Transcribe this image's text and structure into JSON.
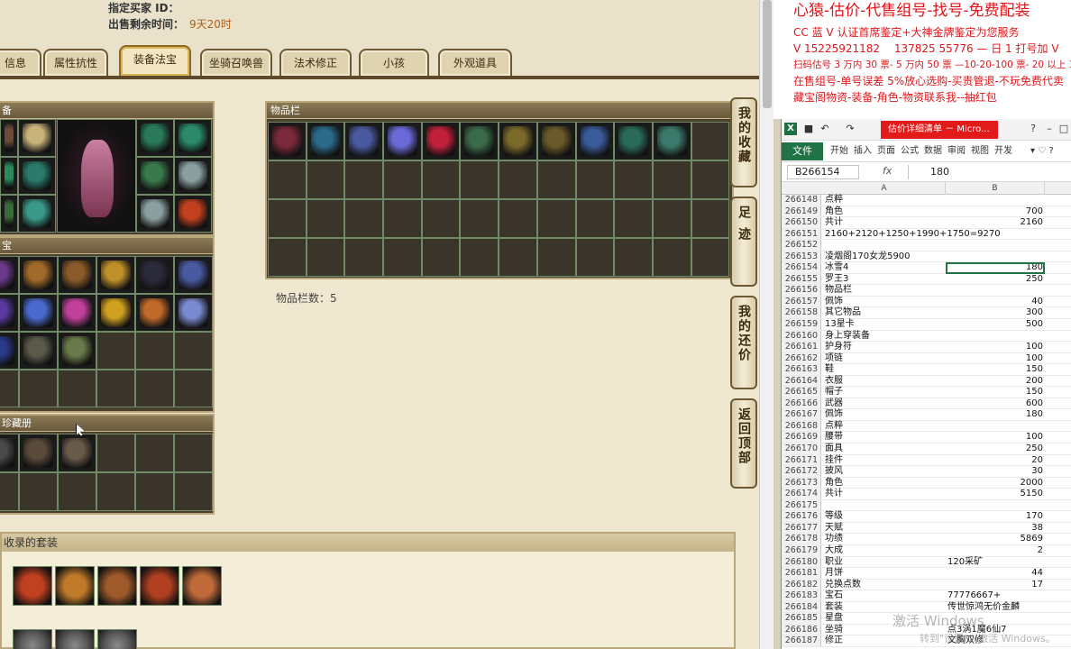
{
  "header": {
    "seller_id_label": "指定买家 ID：",
    "remaining_label": "出售剩余时间：",
    "remaining_value": "9天20时"
  },
  "tabs": [
    {
      "label": "信息"
    },
    {
      "label": "属性抗性"
    },
    {
      "label": "装备法宝",
      "active": true
    },
    {
      "label": "坐骑召唤兽"
    },
    {
      "label": "法术修正"
    },
    {
      "label": "小孩"
    },
    {
      "label": "外观道具"
    }
  ],
  "panels": {
    "equip_title": "备",
    "fabao_title": "宝",
    "xiangce_title": "珍藏册",
    "bag_title": "物品栏",
    "bag_count_label": "物品栏数：5",
    "suit_title": "收录的套装"
  },
  "side_buttons": [
    {
      "label": "我的收藏"
    },
    {
      "label": "足迹"
    },
    {
      "label": "我的还价"
    },
    {
      "label": "返回顶部"
    }
  ],
  "colors": {
    "item_colors_bag": [
      "#7a2a3a",
      "#2b6a8a",
      "#4a5aa0",
      "#6a6ad8",
      "#c0203a",
      "#3a6a4a",
      "#7a6a2a",
      "#6a5a2a",
      "#3a5a9a",
      "#2a6a5a",
      "#3a7a6a"
    ],
    "item_colors_equip": [
      "#6a4a3a",
      "#c8b47a",
      "#2a8a5a",
      "#2a7a6a",
      "#3a6a3a",
      "#3a9a8a",
      "#2a7a5a",
      "#2a8a6a",
      "#3a7a4a",
      "#8aa0a0",
      "#c04020"
    ],
    "item_colors_fabao": [
      "#6a3a8a",
      "#a06a2a",
      "#8a5a2a",
      "#c0902a",
      "#2a2a3a",
      "#4a5aa0",
      "#5a3aa0",
      "#4a6ad0",
      "#c0409a",
      "#d0a020",
      "#c06a2a",
      "#7a8ad0",
      "#2a3a8a",
      "#5a5a4a",
      "#6a7a4a"
    ],
    "item_colors_suit": [
      "#c04020",
      "#c07a2a",
      "#a05a2a",
      "#b04020",
      "#c06a3a"
    ]
  },
  "ad": {
    "title": "心猿-估价-代售组号-找号-免费配装",
    "lines": [
      "CC 蓝 V 认证首席鉴定+大神金牌鉴定为您服务",
      "V 15225921182 　137825 55776 — 日 1 打号加 V",
      "扫码估号 3 万内 30 票- 5 万内 50 票 —10-20-100 票- 20 以上 150",
      "在售组号-单号误差 5%放心选购-买贵管退-不玩免费代卖",
      "藏宝阁物资-装备-角色-物资联系我--抽红包"
    ]
  },
  "excel": {
    "doc_title": "估价详细清单 － Micro...",
    "ribbon_file": "文件",
    "ribbon_tabs": [
      "开始",
      "插入",
      "页面",
      "公式",
      "数据",
      "审阅",
      "视图",
      "开发"
    ],
    "name_box": "B266154",
    "fx": "fx",
    "formula": "180",
    "col_a": "A",
    "col_b": "B",
    "rows": [
      {
        "n": "266148",
        "a": "点粹",
        "b": ""
      },
      {
        "n": "266149",
        "a": "角色",
        "b": "700"
      },
      {
        "n": "266150",
        "a": "共计",
        "b": "2160"
      },
      {
        "n": "266151",
        "a": "2160+2120+1250+1990+1750=9270",
        "b": ""
      },
      {
        "n": "266152",
        "a": "",
        "b": ""
      },
      {
        "n": "266153",
        "a": "凌烟阁170女龙5900",
        "b": ""
      },
      {
        "n": "266154",
        "a": "冰雪4",
        "b": "180",
        "sel": true
      },
      {
        "n": "266155",
        "a": "罗王3",
        "b": "250"
      },
      {
        "n": "266156",
        "a": "物品栏",
        "b": ""
      },
      {
        "n": "266157",
        "a": "佩饰",
        "b": "40"
      },
      {
        "n": "266158",
        "a": "其它物品",
        "b": "300"
      },
      {
        "n": "266159",
        "a": "13星卡",
        "b": "500"
      },
      {
        "n": "266160",
        "a": "身上穿装备",
        "b": ""
      },
      {
        "n": "266161",
        "a": "护身符",
        "b": "100"
      },
      {
        "n": "266162",
        "a": "项链",
        "b": "100"
      },
      {
        "n": "266163",
        "a": "鞋",
        "b": "150"
      },
      {
        "n": "266164",
        "a": "衣服",
        "b": "200"
      },
      {
        "n": "266165",
        "a": "帽子",
        "b": "150"
      },
      {
        "n": "266166",
        "a": "武器",
        "b": "600"
      },
      {
        "n": "266167",
        "a": "佩饰",
        "b": "180"
      },
      {
        "n": "266168",
        "a": "点粹",
        "b": ""
      },
      {
        "n": "266169",
        "a": "腰带",
        "b": "100"
      },
      {
        "n": "266170",
        "a": "面具",
        "b": "250"
      },
      {
        "n": "266171",
        "a": "挂件",
        "b": "20"
      },
      {
        "n": "266172",
        "a": "披风",
        "b": "30"
      },
      {
        "n": "266173",
        "a": "角色",
        "b": "2000"
      },
      {
        "n": "266174",
        "a": "共计",
        "b": "5150"
      },
      {
        "n": "266175",
        "a": "",
        "b": ""
      },
      {
        "n": "266176",
        "a": "等级",
        "b": "170"
      },
      {
        "n": "266177",
        "a": "天赋",
        "b": "38"
      },
      {
        "n": "266178",
        "a": "功绩",
        "b": "5869"
      },
      {
        "n": "266179",
        "a": "大成",
        "b": "2"
      },
      {
        "n": "266180",
        "a": "职业",
        "b": "120采矿",
        "left": true
      },
      {
        "n": "266181",
        "a": "月饼",
        "b": "44"
      },
      {
        "n": "266182",
        "a": "兑换点数",
        "b": "17"
      },
      {
        "n": "266183",
        "a": "宝石",
        "b": "77776667+",
        "left": true
      },
      {
        "n": "266184",
        "a": "套装",
        "b": "传世惊鸿无价金麟",
        "left": true
      },
      {
        "n": "266185",
        "a": "星盘",
        "b": "",
        "left": true
      },
      {
        "n": "266186",
        "a": "坐骑",
        "b": "点3涡1魔6仙7",
        "left": true
      },
      {
        "n": "266187",
        "a": "修正",
        "b": "文胸双修",
        "left": true
      }
    ]
  },
  "watermark": {
    "line1": "激活 Windows",
    "line2": "转到\"设置\"以激活 Windows。"
  }
}
